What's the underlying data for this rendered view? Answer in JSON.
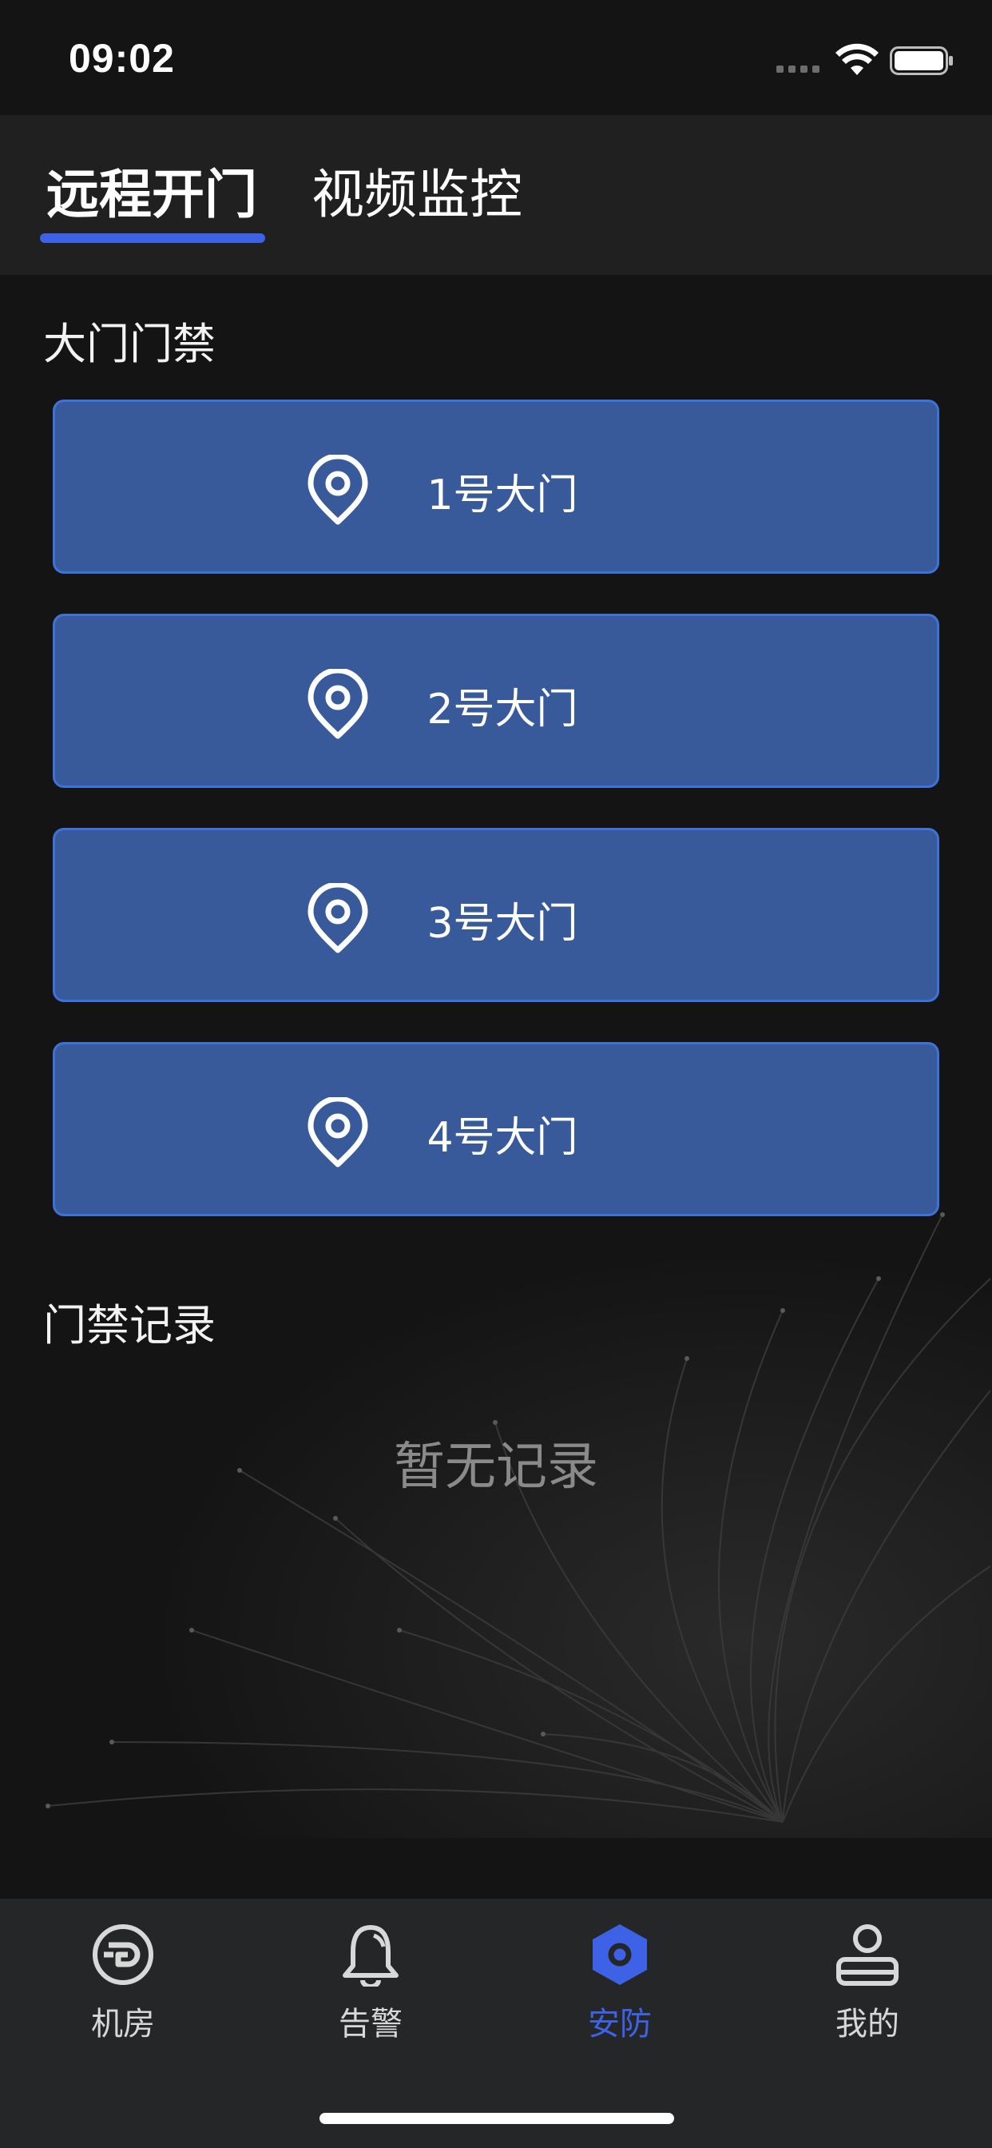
{
  "status_bar": {
    "time": "09:02"
  },
  "tabs": [
    {
      "label": "远程开门",
      "active": true
    },
    {
      "label": "视频监控",
      "active": false
    }
  ],
  "gate_section": {
    "title": "大门门禁",
    "gates": [
      {
        "label": "1号大门",
        "icon": "location-pin-icon"
      },
      {
        "label": "2号大门",
        "icon": "location-pin-icon"
      },
      {
        "label": "3号大门",
        "icon": "location-pin-icon"
      },
      {
        "label": "4号大门",
        "icon": "location-pin-icon"
      }
    ]
  },
  "record_section": {
    "title": "门禁记录",
    "empty_text": "暂无记录"
  },
  "bottom_nav": [
    {
      "label": "机房",
      "icon": "server-room-icon",
      "active": false
    },
    {
      "label": "告警",
      "icon": "bell-icon",
      "active": false
    },
    {
      "label": "安防",
      "icon": "hexagon-security-icon",
      "active": true
    },
    {
      "label": "我的",
      "icon": "user-icon",
      "active": false
    }
  ],
  "colors": {
    "accent": "#3d62e6",
    "gate_button_bg": "#385a9b",
    "gate_button_border": "#3f72d9",
    "background": "#141414",
    "tab_bar_bg": "#202020",
    "bottom_nav_bg": "#252628"
  }
}
